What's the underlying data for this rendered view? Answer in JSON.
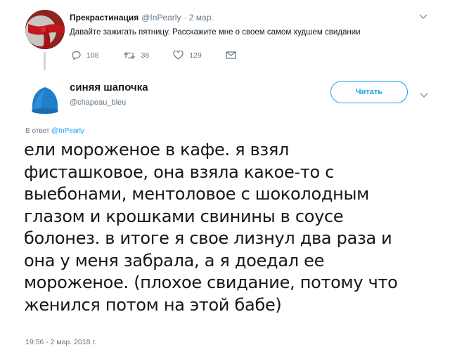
{
  "parent_tweet": {
    "name": "Прекрастинация",
    "handle": "@InPearly",
    "date": "· 2 мар.",
    "text": "Давайте зажигать пятницу. Расскажите мне о своем самом худшем свидании",
    "replies": "108",
    "retweets": "38",
    "likes": "129",
    "icons": [
      "reply-icon",
      "retweet-icon",
      "heart-icon",
      "message-icon",
      "chevron-down-icon"
    ]
  },
  "main_tweet": {
    "name": "синяя шапочка",
    "handle": "@chapeau_bleu",
    "follow_label": "Читать",
    "reply_prefix": "В ответ",
    "reply_mention": "@InPearly",
    "text_lines": [
      "ели мороженое в кафе. я взял",
      "фисташковое, она взяла какое-то с",
      "выебонами, ментоловое с шоколодным",
      "глазом и крошками свинины в соусе",
      "болонез. в итоге я свое лизнул два раза и",
      "она у меня забрала, а я доедал ее",
      "мороженое.  (плохое свидание, потому что",
      "женился потом на этой бабе)"
    ],
    "timestamp": "19:56 - 2 мар. 2018 г.",
    "icons": [
      "chevron-down-icon"
    ]
  },
  "colors": {
    "accent": "#1da1f2",
    "secondary_text": "#657786",
    "primary_text": "#14171a",
    "parent_avatar": "#c01f2c",
    "main_avatar": "#1f7fc9"
  }
}
